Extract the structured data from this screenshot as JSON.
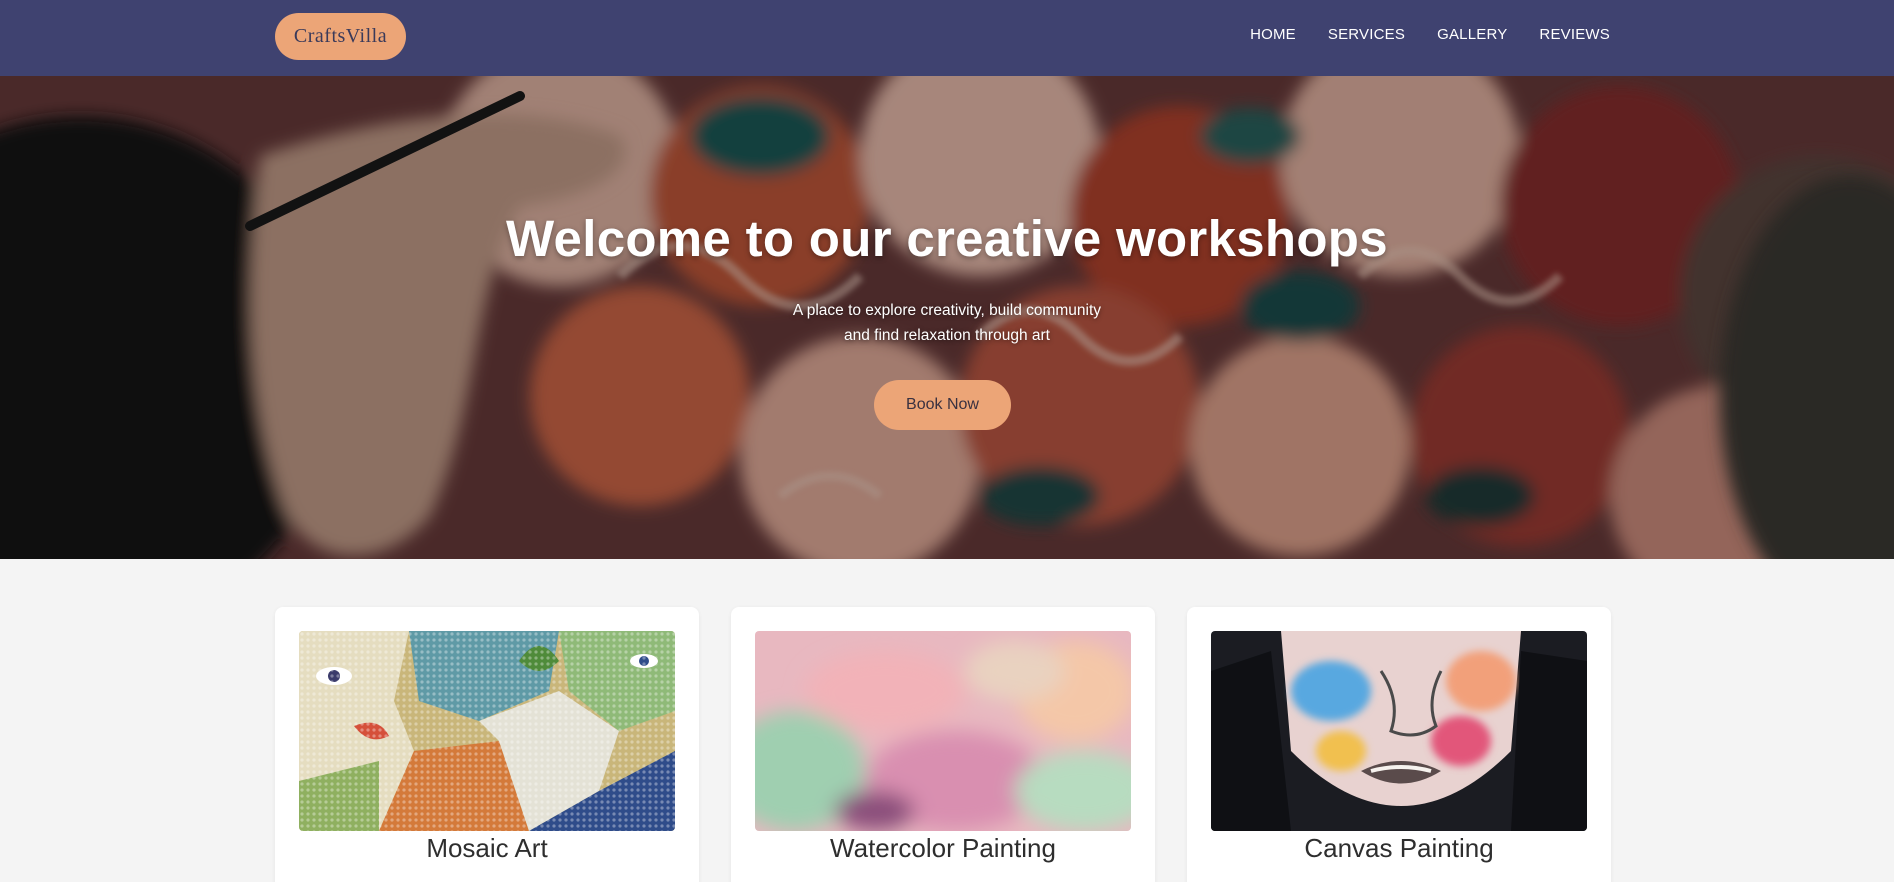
{
  "brand": {
    "logo_text": "CraftsVilla"
  },
  "nav": {
    "items": [
      {
        "label": "HOME"
      },
      {
        "label": "SERVICES"
      },
      {
        "label": "GALLERY"
      },
      {
        "label": "REVIEWS"
      }
    ]
  },
  "hero": {
    "title": "Welcome to our creative workshops",
    "subtitle_line1": "A place to explore creativity, build community",
    "subtitle_line2": "and find relaxation through art",
    "cta_label": "Book Now"
  },
  "cards": [
    {
      "title": "Mosaic Art"
    },
    {
      "title": "Watercolor Painting"
    },
    {
      "title": "Canvas Painting"
    }
  ],
  "colors": {
    "nav_bg": "#3f4270",
    "accent": "#eca577",
    "page_bg": "#f4f4f4"
  }
}
